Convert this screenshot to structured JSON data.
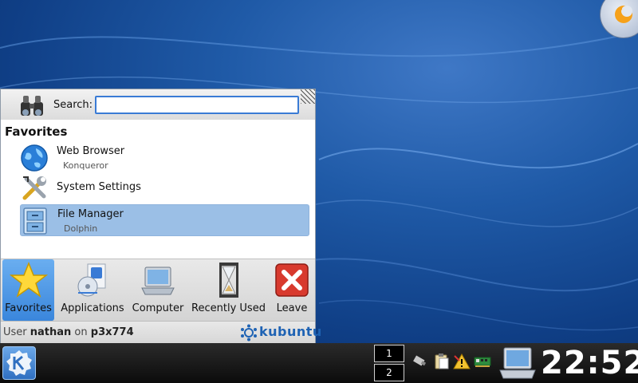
{
  "kickoff": {
    "search": {
      "label": "Search:",
      "value": "",
      "placeholder": ""
    },
    "section_title": "Favorites",
    "favorites": [
      {
        "title": "Web Browser",
        "subtitle": "Konqueror",
        "icon": "globe-icon",
        "selected": false
      },
      {
        "title": "System Settings",
        "subtitle": "",
        "icon": "tools-icon",
        "selected": false
      },
      {
        "title": "File Manager",
        "subtitle": "Dolphin",
        "icon": "file-cabinet-icon",
        "selected": true
      }
    ],
    "tabs": [
      {
        "label": "Favorites",
        "icon": "star-icon",
        "active": true
      },
      {
        "label": "Applications",
        "icon": "applications-icon",
        "active": false
      },
      {
        "label": "Computer",
        "icon": "computer-icon",
        "active": false
      },
      {
        "label": "Recently Used",
        "icon": "hourglass-icon",
        "active": false
      },
      {
        "label": "Leave",
        "icon": "leave-icon",
        "active": false
      }
    ],
    "footer": {
      "user_prefix": "User ",
      "user": "nathan",
      "host_prefix": " on ",
      "host": "p3x774",
      "brand": "kubuntu"
    }
  },
  "panel": {
    "desktops": [
      "1",
      "2"
    ],
    "clock": "22:52",
    "tray_icons": [
      "usb-icon",
      "clipboard-icon",
      "warning-icon",
      "network-card-icon"
    ]
  },
  "colors": {
    "selection": "#9bbfe6",
    "active_tab": "#3a86dc",
    "brand": "#1f63b4"
  }
}
